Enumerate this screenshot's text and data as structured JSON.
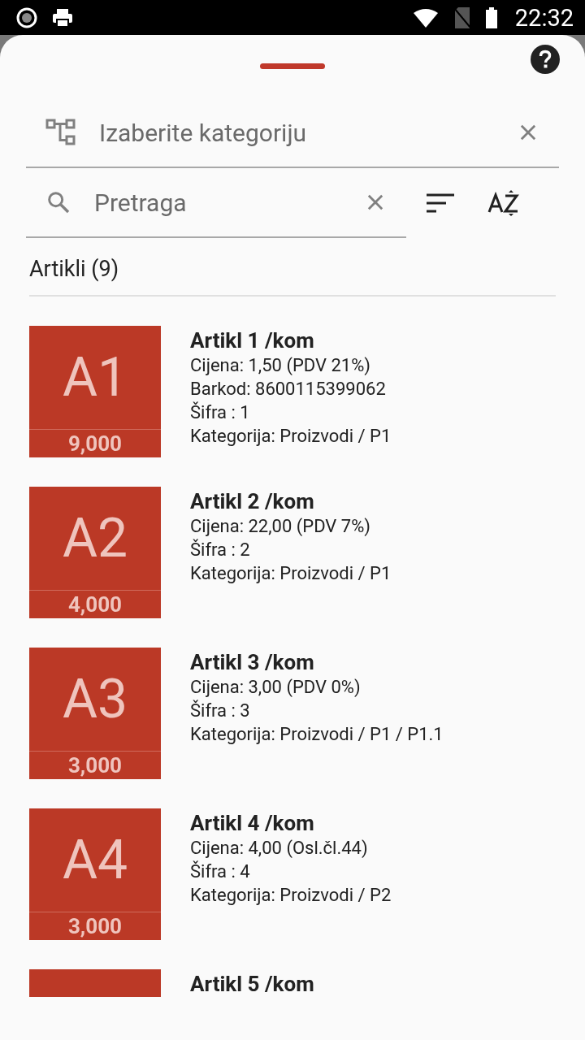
{
  "status_bar": {
    "time": "22:32"
  },
  "category": {
    "placeholder": "Izaberite kategoriju"
  },
  "search": {
    "placeholder": "Pretraga"
  },
  "list_title": "Artikli (9)",
  "items": [
    {
      "code": "A1",
      "stock": "9,000",
      "title": "Artikl 1 /kom",
      "lines": [
        "Cijena: 1,50 (PDV 21%)",
        "Barkod: 8600115399062",
        "Šifra : 1",
        "Kategorija: Proizvodi / P1"
      ]
    },
    {
      "code": "A2",
      "stock": "4,000",
      "title": "Artikl 2 /kom",
      "lines": [
        "Cijena: 22,00 (PDV 7%)",
        "Šifra : 2",
        "Kategorija: Proizvodi / P1"
      ]
    },
    {
      "code": "A3",
      "stock": "3,000",
      "title": "Artikl 3 /kom",
      "lines": [
        "Cijena: 3,00 (PDV 0%)",
        "Šifra : 3",
        "Kategorija: Proizvodi / P1 / P1.1"
      ]
    },
    {
      "code": "A4",
      "stock": "3,000",
      "title": "Artikl 4 /kom",
      "lines": [
        "Cijena: 4,00 (Osl.čl.44)",
        "Šifra : 4",
        "Kategorija: Proizvodi / P2"
      ]
    },
    {
      "title": "Artikl 5 /kom"
    }
  ]
}
